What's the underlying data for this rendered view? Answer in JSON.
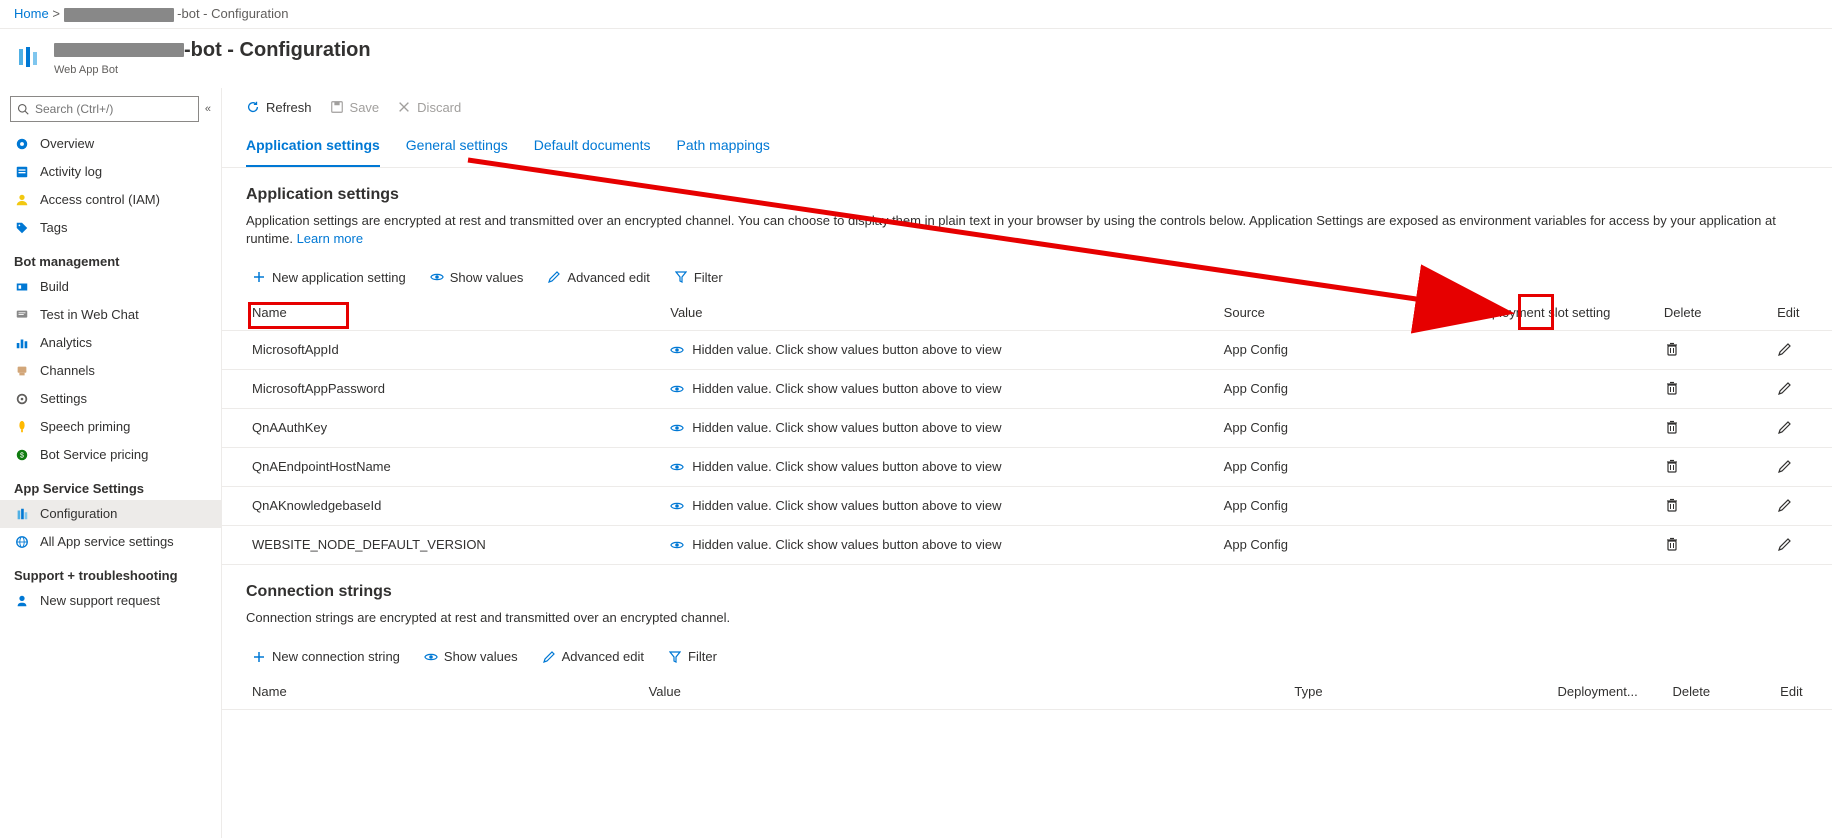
{
  "breadcrumb": {
    "home": "Home",
    "sep": " > ",
    "tail": "-bot - Configuration"
  },
  "header": {
    "title_suffix": "-bot - Configuration",
    "subtitle": "Web App Bot"
  },
  "sidebar": {
    "search_placeholder": "Search (Ctrl+/)",
    "items_top": [
      {
        "label": "Overview",
        "icon": "overview"
      },
      {
        "label": "Activity log",
        "icon": "activity"
      },
      {
        "label": "Access control (IAM)",
        "icon": "iam"
      },
      {
        "label": "Tags",
        "icon": "tags"
      }
    ],
    "section_bot": "Bot management",
    "items_bot": [
      {
        "label": "Build",
        "icon": "build"
      },
      {
        "label": "Test in Web Chat",
        "icon": "test"
      },
      {
        "label": "Analytics",
        "icon": "analytics"
      },
      {
        "label": "Channels",
        "icon": "channels"
      },
      {
        "label": "Settings",
        "icon": "settings"
      },
      {
        "label": "Speech priming",
        "icon": "speech"
      },
      {
        "label": "Bot Service pricing",
        "icon": "pricing"
      }
    ],
    "section_appsvc": "App Service Settings",
    "items_appsvc": [
      {
        "label": "Configuration",
        "icon": "config",
        "active": true
      },
      {
        "label": "All App service settings",
        "icon": "allsettings"
      }
    ],
    "section_support": "Support + troubleshooting",
    "items_support": [
      {
        "label": "New support request",
        "icon": "support"
      }
    ]
  },
  "toolbar": {
    "refresh": "Refresh",
    "save": "Save",
    "discard": "Discard"
  },
  "tabs": [
    {
      "label": "Application settings",
      "active": true
    },
    {
      "label": "General settings"
    },
    {
      "label": "Default documents"
    },
    {
      "label": "Path mappings"
    }
  ],
  "appsettings": {
    "heading": "Application settings",
    "desc": "Application settings are encrypted at rest and transmitted over an encrypted channel. You can choose to display them in plain text in your browser by using the controls below. Application Settings are exposed as environment variables for access by your application at runtime. ",
    "learn_more": "Learn more",
    "actions": {
      "new": "New application setting",
      "show": "Show values",
      "advanced": "Advanced edit",
      "filter": "Filter"
    },
    "columns": {
      "name": "Name",
      "value": "Value",
      "source": "Source",
      "deploy": "Deployment slot setting",
      "delete": "Delete",
      "edit": "Edit"
    },
    "hidden_text": "Hidden value. Click show values button above to view",
    "rows": [
      {
        "name": "MicrosoftAppId",
        "source": "App Config"
      },
      {
        "name": "MicrosoftAppPassword",
        "source": "App Config"
      },
      {
        "name": "QnAAuthKey",
        "source": "App Config"
      },
      {
        "name": "QnAEndpointHostName",
        "source": "App Config"
      },
      {
        "name": "QnAKnowledgebaseId",
        "source": "App Config"
      },
      {
        "name": "WEBSITE_NODE_DEFAULT_VERSION",
        "source": "App Config"
      }
    ]
  },
  "connstrings": {
    "heading": "Connection strings",
    "desc": "Connection strings are encrypted at rest and transmitted over an encrypted channel.",
    "actions": {
      "new": "New connection string",
      "show": "Show values",
      "advanced": "Advanced edit",
      "filter": "Filter"
    },
    "columns": {
      "name": "Name",
      "value": "Value",
      "type": "Type",
      "deploy": "Deployment...",
      "delete": "Delete",
      "edit": "Edit"
    }
  }
}
